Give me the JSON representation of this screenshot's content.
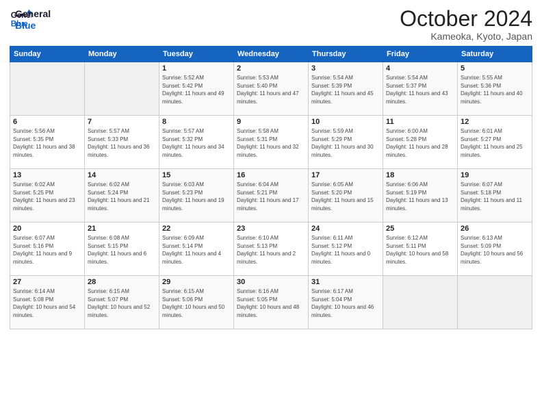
{
  "header": {
    "logo_line1": "General",
    "logo_line2": "Blue",
    "month": "October 2024",
    "location": "Kameoka, Kyoto, Japan"
  },
  "days_of_week": [
    "Sunday",
    "Monday",
    "Tuesday",
    "Wednesday",
    "Thursday",
    "Friday",
    "Saturday"
  ],
  "weeks": [
    [
      {
        "day": "",
        "detail": ""
      },
      {
        "day": "",
        "detail": ""
      },
      {
        "day": "1",
        "detail": "Sunrise: 5:52 AM\nSunset: 5:42 PM\nDaylight: 11 hours and 49 minutes."
      },
      {
        "day": "2",
        "detail": "Sunrise: 5:53 AM\nSunset: 5:40 PM\nDaylight: 11 hours and 47 minutes."
      },
      {
        "day": "3",
        "detail": "Sunrise: 5:54 AM\nSunset: 5:39 PM\nDaylight: 11 hours and 45 minutes."
      },
      {
        "day": "4",
        "detail": "Sunrise: 5:54 AM\nSunset: 5:37 PM\nDaylight: 11 hours and 43 minutes."
      },
      {
        "day": "5",
        "detail": "Sunrise: 5:55 AM\nSunset: 5:36 PM\nDaylight: 11 hours and 40 minutes."
      }
    ],
    [
      {
        "day": "6",
        "detail": "Sunrise: 5:56 AM\nSunset: 5:35 PM\nDaylight: 11 hours and 38 minutes."
      },
      {
        "day": "7",
        "detail": "Sunrise: 5:57 AM\nSunset: 5:33 PM\nDaylight: 11 hours and 36 minutes."
      },
      {
        "day": "8",
        "detail": "Sunrise: 5:57 AM\nSunset: 5:32 PM\nDaylight: 11 hours and 34 minutes."
      },
      {
        "day": "9",
        "detail": "Sunrise: 5:58 AM\nSunset: 5:31 PM\nDaylight: 11 hours and 32 minutes."
      },
      {
        "day": "10",
        "detail": "Sunrise: 5:59 AM\nSunset: 5:29 PM\nDaylight: 11 hours and 30 minutes."
      },
      {
        "day": "11",
        "detail": "Sunrise: 6:00 AM\nSunset: 5:28 PM\nDaylight: 11 hours and 28 minutes."
      },
      {
        "day": "12",
        "detail": "Sunrise: 6:01 AM\nSunset: 5:27 PM\nDaylight: 11 hours and 25 minutes."
      }
    ],
    [
      {
        "day": "13",
        "detail": "Sunrise: 6:02 AM\nSunset: 5:25 PM\nDaylight: 11 hours and 23 minutes."
      },
      {
        "day": "14",
        "detail": "Sunrise: 6:02 AM\nSunset: 5:24 PM\nDaylight: 11 hours and 21 minutes."
      },
      {
        "day": "15",
        "detail": "Sunrise: 6:03 AM\nSunset: 5:23 PM\nDaylight: 11 hours and 19 minutes."
      },
      {
        "day": "16",
        "detail": "Sunrise: 6:04 AM\nSunset: 5:21 PM\nDaylight: 11 hours and 17 minutes."
      },
      {
        "day": "17",
        "detail": "Sunrise: 6:05 AM\nSunset: 5:20 PM\nDaylight: 11 hours and 15 minutes."
      },
      {
        "day": "18",
        "detail": "Sunrise: 6:06 AM\nSunset: 5:19 PM\nDaylight: 11 hours and 13 minutes."
      },
      {
        "day": "19",
        "detail": "Sunrise: 6:07 AM\nSunset: 5:18 PM\nDaylight: 11 hours and 11 minutes."
      }
    ],
    [
      {
        "day": "20",
        "detail": "Sunrise: 6:07 AM\nSunset: 5:16 PM\nDaylight: 11 hours and 9 minutes."
      },
      {
        "day": "21",
        "detail": "Sunrise: 6:08 AM\nSunset: 5:15 PM\nDaylight: 11 hours and 6 minutes."
      },
      {
        "day": "22",
        "detail": "Sunrise: 6:09 AM\nSunset: 5:14 PM\nDaylight: 11 hours and 4 minutes."
      },
      {
        "day": "23",
        "detail": "Sunrise: 6:10 AM\nSunset: 5:13 PM\nDaylight: 11 hours and 2 minutes."
      },
      {
        "day": "24",
        "detail": "Sunrise: 6:11 AM\nSunset: 5:12 PM\nDaylight: 11 hours and 0 minutes."
      },
      {
        "day": "25",
        "detail": "Sunrise: 6:12 AM\nSunset: 5:11 PM\nDaylight: 10 hours and 58 minutes."
      },
      {
        "day": "26",
        "detail": "Sunrise: 6:13 AM\nSunset: 5:09 PM\nDaylight: 10 hours and 56 minutes."
      }
    ],
    [
      {
        "day": "27",
        "detail": "Sunrise: 6:14 AM\nSunset: 5:08 PM\nDaylight: 10 hours and 54 minutes."
      },
      {
        "day": "28",
        "detail": "Sunrise: 6:15 AM\nSunset: 5:07 PM\nDaylight: 10 hours and 52 minutes."
      },
      {
        "day": "29",
        "detail": "Sunrise: 6:15 AM\nSunset: 5:06 PM\nDaylight: 10 hours and 50 minutes."
      },
      {
        "day": "30",
        "detail": "Sunrise: 6:16 AM\nSunset: 5:05 PM\nDaylight: 10 hours and 48 minutes."
      },
      {
        "day": "31",
        "detail": "Sunrise: 6:17 AM\nSunset: 5:04 PM\nDaylight: 10 hours and 46 minutes."
      },
      {
        "day": "",
        "detail": ""
      },
      {
        "day": "",
        "detail": ""
      }
    ]
  ]
}
